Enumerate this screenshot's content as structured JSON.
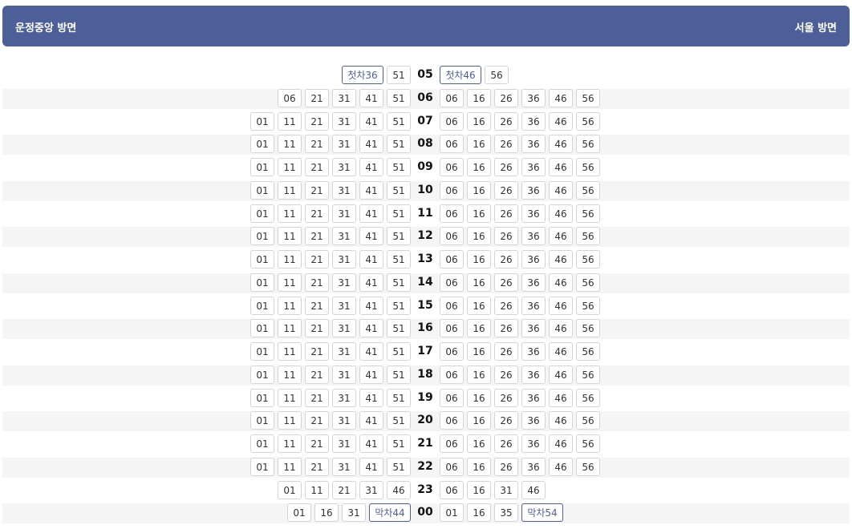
{
  "header": {
    "left_direction": "운정중앙 방면",
    "right_direction": "서울 방면"
  },
  "rows": [
    {
      "hour": "05",
      "left": [
        "첫차36",
        "51"
      ],
      "right": [
        "첫차46",
        "56"
      ]
    },
    {
      "hour": "06",
      "left": [
        "06",
        "21",
        "31",
        "41",
        "51"
      ],
      "right": [
        "06",
        "16",
        "26",
        "36",
        "46",
        "56"
      ]
    },
    {
      "hour": "07",
      "left": [
        "01",
        "11",
        "21",
        "31",
        "41",
        "51"
      ],
      "right": [
        "06",
        "16",
        "26",
        "36",
        "46",
        "56"
      ]
    },
    {
      "hour": "08",
      "left": [
        "01",
        "11",
        "21",
        "31",
        "41",
        "51"
      ],
      "right": [
        "06",
        "16",
        "26",
        "36",
        "46",
        "56"
      ]
    },
    {
      "hour": "09",
      "left": [
        "01",
        "11",
        "21",
        "31",
        "41",
        "51"
      ],
      "right": [
        "06",
        "16",
        "26",
        "36",
        "46",
        "56"
      ]
    },
    {
      "hour": "10",
      "left": [
        "01",
        "11",
        "21",
        "31",
        "41",
        "51"
      ],
      "right": [
        "06",
        "16",
        "26",
        "36",
        "46",
        "56"
      ]
    },
    {
      "hour": "11",
      "left": [
        "01",
        "11",
        "21",
        "31",
        "41",
        "51"
      ],
      "right": [
        "06",
        "16",
        "26",
        "36",
        "46",
        "56"
      ]
    },
    {
      "hour": "12",
      "left": [
        "01",
        "11",
        "21",
        "31",
        "41",
        "51"
      ],
      "right": [
        "06",
        "16",
        "26",
        "36",
        "46",
        "56"
      ]
    },
    {
      "hour": "13",
      "left": [
        "01",
        "11",
        "21",
        "31",
        "41",
        "51"
      ],
      "right": [
        "06",
        "16",
        "26",
        "36",
        "46",
        "56"
      ]
    },
    {
      "hour": "14",
      "left": [
        "01",
        "11",
        "21",
        "31",
        "41",
        "51"
      ],
      "right": [
        "06",
        "16",
        "26",
        "36",
        "46",
        "56"
      ]
    },
    {
      "hour": "15",
      "left": [
        "01",
        "11",
        "21",
        "31",
        "41",
        "51"
      ],
      "right": [
        "06",
        "16",
        "26",
        "36",
        "46",
        "56"
      ]
    },
    {
      "hour": "16",
      "left": [
        "01",
        "11",
        "21",
        "31",
        "41",
        "51"
      ],
      "right": [
        "06",
        "16",
        "26",
        "36",
        "46",
        "56"
      ]
    },
    {
      "hour": "17",
      "left": [
        "01",
        "11",
        "21",
        "31",
        "41",
        "51"
      ],
      "right": [
        "06",
        "16",
        "26",
        "36",
        "46",
        "56"
      ]
    },
    {
      "hour": "18",
      "left": [
        "01",
        "11",
        "21",
        "31",
        "41",
        "51"
      ],
      "right": [
        "06",
        "16",
        "26",
        "36",
        "46",
        "56"
      ]
    },
    {
      "hour": "19",
      "left": [
        "01",
        "11",
        "21",
        "31",
        "41",
        "51"
      ],
      "right": [
        "06",
        "16",
        "26",
        "36",
        "46",
        "56"
      ]
    },
    {
      "hour": "20",
      "left": [
        "01",
        "11",
        "21",
        "31",
        "41",
        "51"
      ],
      "right": [
        "06",
        "16",
        "26",
        "36",
        "46",
        "56"
      ]
    },
    {
      "hour": "21",
      "left": [
        "01",
        "11",
        "21",
        "31",
        "41",
        "51"
      ],
      "right": [
        "06",
        "16",
        "26",
        "36",
        "46",
        "56"
      ]
    },
    {
      "hour": "22",
      "left": [
        "01",
        "11",
        "21",
        "31",
        "41",
        "51"
      ],
      "right": [
        "06",
        "16",
        "26",
        "36",
        "46",
        "56"
      ]
    },
    {
      "hour": "23",
      "left": [
        "01",
        "11",
        "21",
        "31",
        "46"
      ],
      "right": [
        "06",
        "16",
        "31",
        "46"
      ]
    },
    {
      "hour": "00",
      "left": [
        "01",
        "16",
        "31",
        "막차44"
      ],
      "right": [
        "01",
        "16",
        "35",
        "막차54"
      ]
    }
  ],
  "colors": {
    "header_bg": "#4d5f99",
    "highlight": "#4d5f99",
    "row_shade": "#f5f5f5"
  }
}
